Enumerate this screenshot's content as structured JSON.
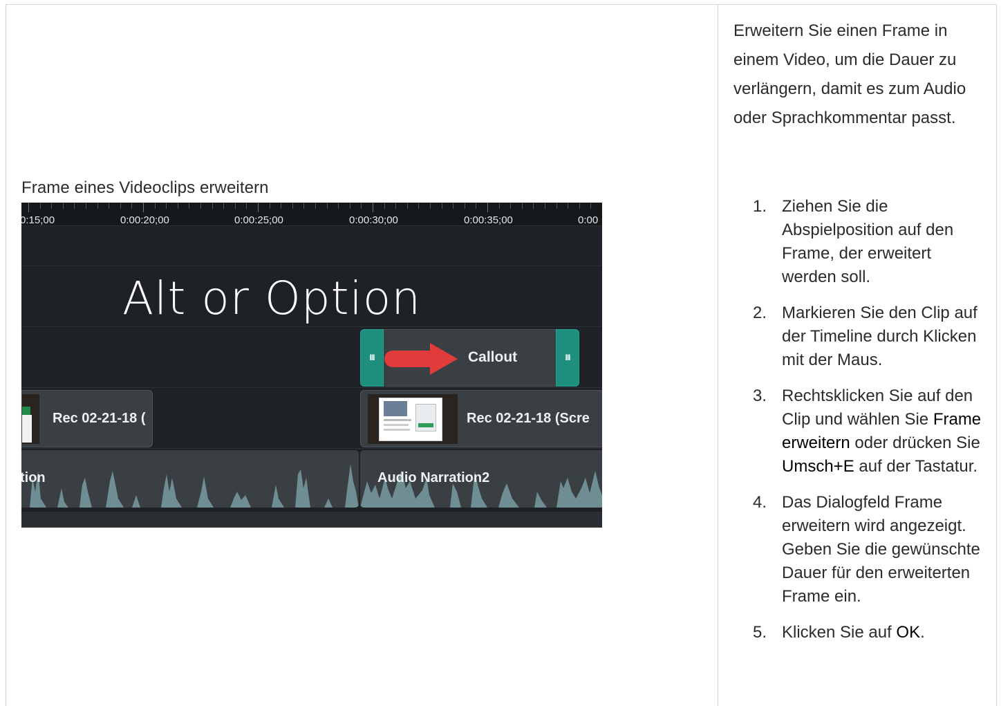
{
  "figure": {
    "caption": "Frame eines Videoclips erweitern",
    "ruler_labels": [
      "0:15;00",
      "0:00:20;00",
      "0:00:25;00",
      "0:00:30;00",
      "0:00:35;00",
      "0:00"
    ],
    "overlay_text": "Alt or Option",
    "callout_label": "Callout",
    "handle_grip": "III",
    "rec_clip_1_label": "Rec 02-21-18 (",
    "rec_clip_2_label": "Rec 02-21-18 (Scre",
    "audio_clip_1_label": "tion",
    "audio_clip_2_label": "Audio Narration2"
  },
  "intro": "Erweitern Sie einen Frame in einem Video, um die Dauer zu verlängern, damit es zum Audio oder Sprachkommentar passt.",
  "steps": [
    {
      "num": "1.",
      "pre": "Ziehen Sie die Abspielposition auf den Frame, der erweitert werden soll."
    },
    {
      "num": "2.",
      "pre": "Markieren Sie den Clip auf der Timeline durch Klicken mit der Maus."
    },
    {
      "num": "3.",
      "pre": "Rechtsklicken Sie auf den Clip und wählen Sie ",
      "hl1": "Frame erweitern",
      "mid": " oder drücken Sie ",
      "hl2": "Umsch+E",
      "post": " auf der Tastatur."
    },
    {
      "num": "4.",
      "pre": "Das Dialogfeld Frame erweitern wird angezeigt. Geben Sie die gewünschte Dauer für den erweiterten Frame ein."
    },
    {
      "num": "5.",
      "pre": "Klicken Sie auf ",
      "hl1": "OK",
      "post": "."
    }
  ],
  "colors": {
    "timeline_bg": "#1e2226",
    "handle_teal": "#1e8e7e",
    "arrow_red": "#e23b3b",
    "clip_gray": "#3a3f44"
  }
}
